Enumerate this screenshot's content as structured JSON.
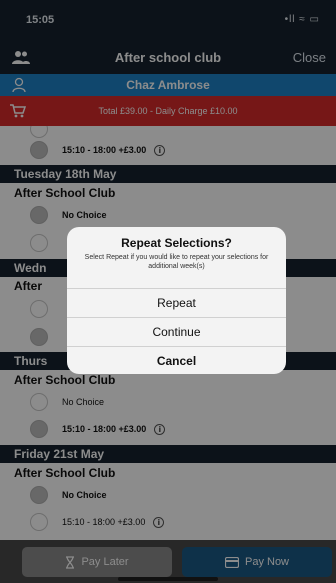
{
  "status": {
    "time": "15:05",
    "signal": "•ll ≈ ▭"
  },
  "nav": {
    "title": "After school club",
    "close_label": "Close"
  },
  "user": {
    "name": "Chaz Ambrose"
  },
  "total": {
    "text": "Total £39.00 - Daily Charge £10.00"
  },
  "list": {
    "top_option": {
      "label": "15:10 - 18:00 +£3.00",
      "info": "i"
    },
    "days": [
      {
        "header": "Tuesday 18th May",
        "club": "After School Club",
        "opt1": "No Choice",
        "opt2": ""
      },
      {
        "header": "Wedn",
        "club": "After",
        "opt1": "",
        "opt2": ""
      },
      {
        "header": "Thurs",
        "club": "After School Club",
        "opt1": "No Choice",
        "opt2": "15:10 - 18:00 +£3.00"
      },
      {
        "header": "Friday 21st May",
        "club": "After School Club",
        "opt1": "No Choice",
        "opt2": "15:10 - 18:00 +£3.00"
      }
    ]
  },
  "alert": {
    "title": "Repeat Selections?",
    "message": "Select Repeat if you would like to repeat your selections for additional week(s)",
    "repeat_label": "Repeat",
    "continue_label": "Continue",
    "cancel_label": "Cancel"
  },
  "footer": {
    "pay_later_label": "Pay Later",
    "pay_now_label": "Pay Now"
  },
  "colors": {
    "header": "#16222e",
    "user_bar": "#1e82c6",
    "total_bar": "#d72b2b",
    "pay_now": "#1a5a86"
  }
}
